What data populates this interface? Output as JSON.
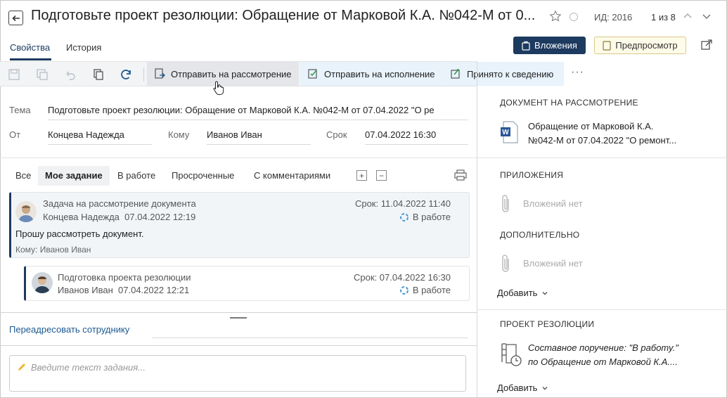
{
  "header": {
    "title": "Подготовьте проект резолюции: Обращение от Марковой К.А. №042-М от 0...",
    "doc_id": "ИД: 2016",
    "pager": "1 из 8"
  },
  "tabs": [
    {
      "label": "Свойства",
      "active": true
    },
    {
      "label": "История",
      "active": false
    }
  ],
  "buttons": {
    "attachments": "Вложения",
    "preview": "Предпросмотр"
  },
  "toolbar": {
    "send_review": "Отправить на рассмотрение",
    "send_execution": "Отправить на исполнение",
    "acknowledge": "Принято к сведению",
    "more": "···"
  },
  "fields": {
    "subject_label": "Тема",
    "subject_value": "Подготовьте проект резолюции: Обращение от Марковой К.А. №042-М от 07.04.2022 \"О ре",
    "from_label": "От",
    "from_value": "Концева Надежда",
    "to_label": "Кому",
    "to_value": "Иванов Иван",
    "due_label": "Срок",
    "due_value": "07.04.2022 16:30"
  },
  "filters": [
    {
      "label": "Все",
      "active": false
    },
    {
      "label": "Мое задание",
      "active": true
    },
    {
      "label": "В работе",
      "active": false
    },
    {
      "label": "Просроченные",
      "active": false
    },
    {
      "label": "С комментариями",
      "active": false
    }
  ],
  "tasks": [
    {
      "title": "Задача на рассмотрение документа",
      "author": "Концева Надежда",
      "date": "07.04.2022 12:19",
      "due": "Срок: 11.04.2022 11:40",
      "status": "В работе",
      "body": "Прошу рассмотреть документ.",
      "to": "Кому: Иванов Иван"
    },
    {
      "title": "Подготовка проекта резолюции",
      "author": "Иванов Иван",
      "date": "07.04.2022 12:21",
      "due": "Срок: 07.04.2022 16:30",
      "status": "В работе"
    }
  ],
  "forward_link": "Переадресовать сотруднику",
  "task_input": {
    "placeholder": "Введите текст задания..."
  },
  "right_panel": {
    "doc_review_header": "ДОКУМЕНТ НА РАССМОТРЕНИЕ",
    "doc_review_line1": "Обращение от Марковой К.А.",
    "doc_review_line2": "№042-М от 07.04.2022 \"О ремонт...",
    "attachments_header": "ПРИЛОЖЕНИЯ",
    "attachments_empty": "Вложений нет",
    "additional_header": "ДОПОЛНИТЕЛЬНО",
    "additional_empty": "Вложений нет",
    "add_label": "Добавить",
    "resolution_header": "ПРОЕКТ РЕЗОЛЮЦИИ",
    "resolution_line1": "Составное поручение: \"В работу.\"",
    "resolution_line2": "по Обращение от Марковой К.А....",
    "add_label2": "Добавить"
  },
  "colors": {
    "primary": "#1d3a5f",
    "preview_bg": "#fffbe9",
    "toolbar_bg": "#f3f4f6",
    "card_bg": "#f2f5f8",
    "link": "#1d5a8f"
  }
}
